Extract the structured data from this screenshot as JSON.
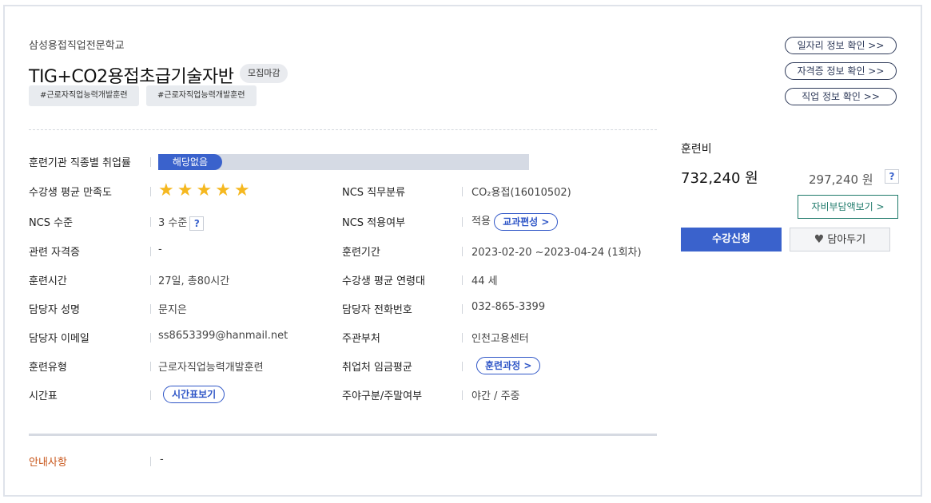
{
  "header": {
    "school": "삼성용접직업전문학교",
    "title": "TIG+CO2용접초급기술자반",
    "status_badge": "모집마감",
    "tags": [
      "#근로자직업능력개발훈련",
      "#근로자직업능력개발훈련"
    ]
  },
  "side_links": [
    "일자리 정보 확인 >>",
    "자격증 정보 확인 >>",
    "직업 정보 확인 >>"
  ],
  "employment_rate": {
    "label": "훈련기관 직종별 취업률",
    "value": "해당없음"
  },
  "satisfaction": {
    "label": "수강생 평균 만족도",
    "stars": 5,
    "max_stars": 5
  },
  "details_left": [
    {
      "label": "NCS 수준",
      "value": "3 수준",
      "help": "?"
    },
    {
      "label": "관련 자격증",
      "value": "-"
    },
    {
      "label": "훈련시간",
      "value": "27일, 총80시간"
    },
    {
      "label": "담당자 성명",
      "value": "문지은"
    },
    {
      "label": "담당자 이메일",
      "value": "ss8653399@hanmail.net"
    },
    {
      "label": "훈련유형",
      "value": "근로자직업능력개발훈련"
    },
    {
      "label": "시간표",
      "button": "시간표보기"
    }
  ],
  "details_right": [
    {
      "label": "NCS 직무분류",
      "value": "CO₂용접(16010502)"
    },
    {
      "label": "NCS 적용여부",
      "value": "적용",
      "button": "교과편성 >"
    },
    {
      "label": "훈련기간",
      "value": "2023-02-20 ~2023-04-24 (1회차)"
    },
    {
      "label": "수강생 평균 연령대",
      "value": "44 세"
    },
    {
      "label": "담당자 전화번호",
      "value": "032-865-3399"
    },
    {
      "label": "주관부처",
      "value": "인천고용센터"
    },
    {
      "label": "취업처 임금평균",
      "button": "훈련과정 >"
    },
    {
      "label": "주야구분/주말여부",
      "value": "야간 / 주중"
    }
  ],
  "notice": {
    "label": "안내사항",
    "value": "-"
  },
  "fee": {
    "label": "훈련비",
    "total": "732,240 원",
    "self_pay": "297,240 원",
    "help": "?",
    "self_pay_button": "자비부담액보기 >",
    "apply_button": "수강신청",
    "wish_button": "담아두기"
  },
  "colors": {
    "accent": "#3a62cc",
    "star": "#f5b820",
    "notice": "#c8561a",
    "teal": "#1f7a6b"
  }
}
